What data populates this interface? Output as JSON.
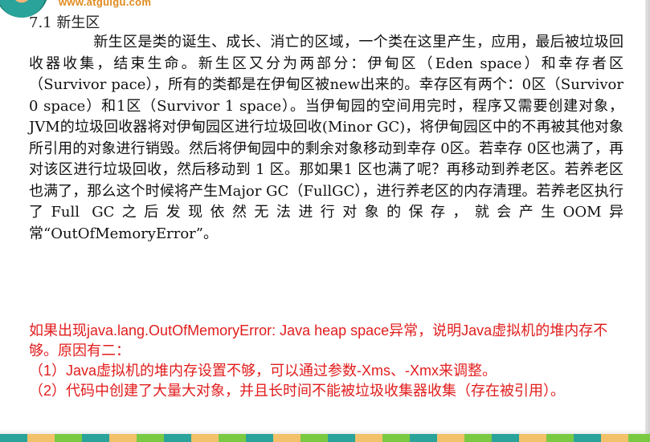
{
  "logo": {
    "url_text": "www.atguigu.com",
    "icon": "atguigu-logo-icon"
  },
  "section": {
    "heading": "7.1 新生区"
  },
  "body": {
    "paragraph": "新生区是类的诞生、成长、消亡的区域，一个类在这里产生，应用，最后被垃圾回收器收集，结束生命。新生区又分为两部分：伊甸区（Eden space）和幸存者区（Survivor pace），所有的类都是在伊甸区被new出来的。幸存区有两个：0区（Survivor 0 space）和1区（Survivor 1 space）。当伊甸园的空间用完时，程序又需要创建对象，JVM的垃圾回收器将对伊甸园区进行垃圾回收(Minor GC)，将伊甸园区中的不再被其他对象所引用的对象进行销毁。然后将伊甸园中的剩余对象移动到幸存 0区。若幸存 0区也满了，再对该区进行垃圾回收，然后移动到 1 区。那如果1 区也满了呢？再移动到养老区。若养老区也满了，那么这个时候将产生Major GC（FullGC），进行养老区的内存清理。若养老区执行了Full GC之后发现依然无法进行对象的保存，就会产生OOM异常“OutOfMemoryError”。"
  },
  "note": {
    "intro": "如果出现java.lang.OutOfMemoryError: Java heap space异常，说明Java虚拟机的堆内存不够。原因有二：",
    "reason_1": "（1）Java虚拟机的堆内存设置不够，可以通过参数-Xms、-Xmx来调整。",
    "reason_2": "（2）代码中创建了大量大对象，并且长时间不能被垃圾收集器收集（存在被引用）。",
    "color": "#e21d1d"
  }
}
